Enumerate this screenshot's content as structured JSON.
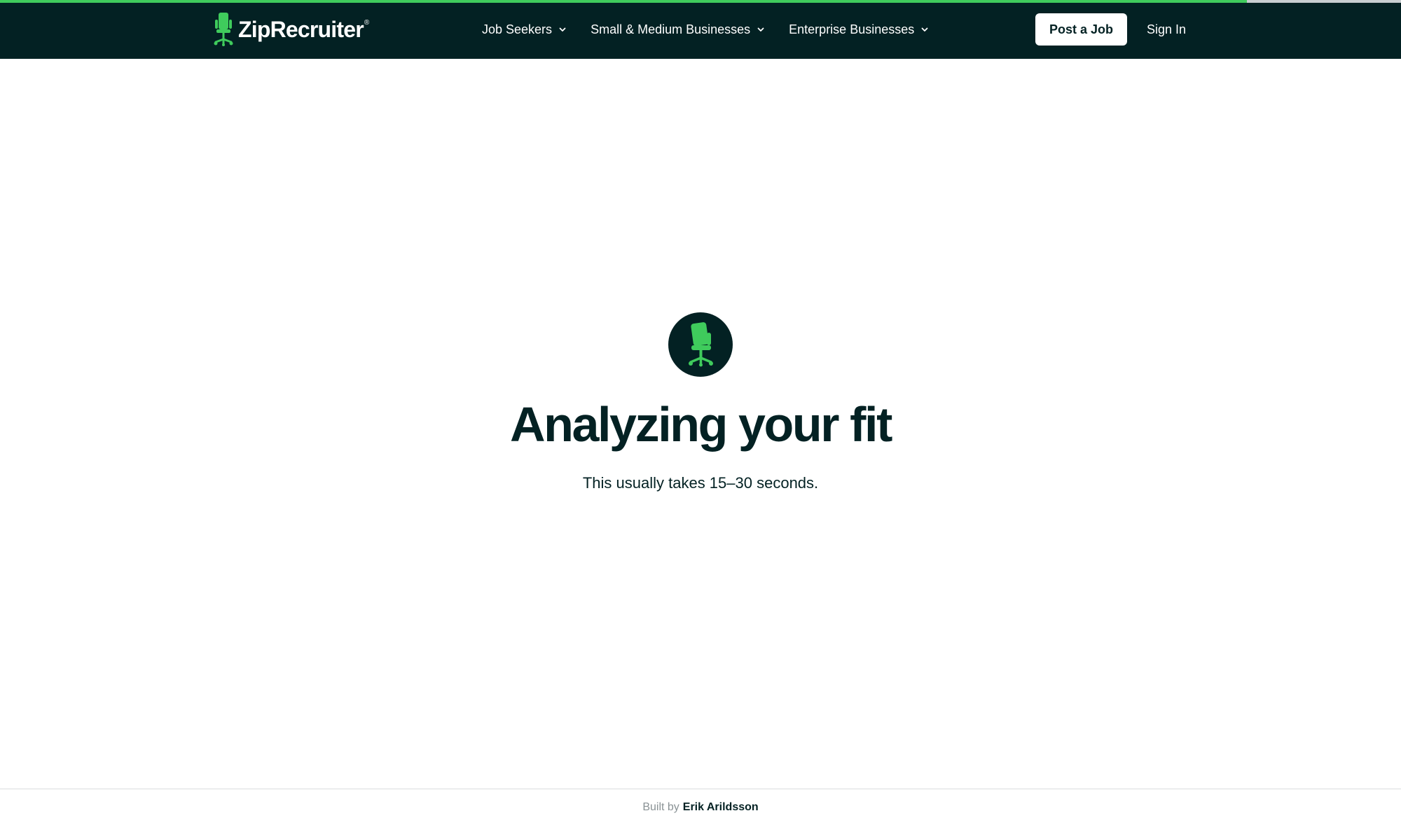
{
  "progress": {
    "fraction": 0.89
  },
  "brand": {
    "name": "ZipRecruiter",
    "registered_mark": "®",
    "accent_color": "#3fcb5c",
    "dark_color": "#032123"
  },
  "header": {
    "nav": [
      {
        "label": "Job Seekers",
        "icon": "chevron-down-icon"
      },
      {
        "label": "Small & Medium Businesses",
        "icon": "chevron-down-icon"
      },
      {
        "label": "Enterprise Businesses",
        "icon": "chevron-down-icon"
      }
    ],
    "post_job_label": "Post a Job",
    "sign_in_label": "Sign In"
  },
  "main": {
    "icon": "office-chair-icon",
    "title": "Analyzing your fit",
    "subtitle": "This usually takes 15–30 seconds."
  },
  "footer": {
    "prefix": "Built by",
    "author": "Erik Arildsson"
  }
}
